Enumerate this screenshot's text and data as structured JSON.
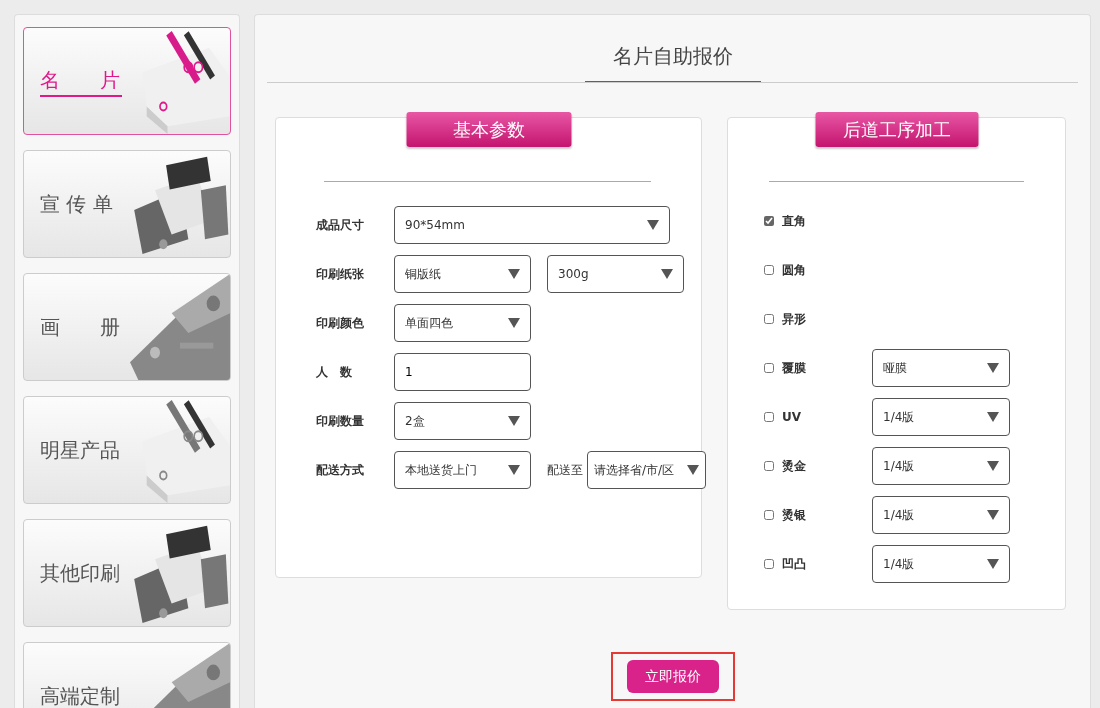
{
  "sidebar": {
    "items": [
      {
        "label": "名　　片",
        "selected": true
      },
      {
        "label": "宣 传 单",
        "selected": false
      },
      {
        "label": "画　　册",
        "selected": false
      },
      {
        "label": "明星产品",
        "selected": false
      },
      {
        "label": "其他印刷",
        "selected": false
      },
      {
        "label": "高端定制",
        "selected": false
      }
    ]
  },
  "title": "名片自助报价",
  "basic": {
    "heading": "基本参数",
    "rows": [
      {
        "label": "成品尺寸",
        "controls": [
          {
            "kind": "select",
            "value": "90*54mm"
          }
        ]
      },
      {
        "label": "印刷纸张",
        "controls": [
          {
            "kind": "select",
            "value": "铜版纸"
          },
          {
            "kind": "select",
            "value": "300g"
          }
        ]
      },
      {
        "label": "印刷颜色",
        "controls": [
          {
            "kind": "select",
            "value": "单面四色"
          }
        ]
      },
      {
        "label": "人　数",
        "controls": [
          {
            "kind": "input",
            "value": "1"
          }
        ]
      },
      {
        "label": "印刷数量",
        "controls": [
          {
            "kind": "select",
            "value": "2盒"
          }
        ]
      },
      {
        "label": "配送方式",
        "controls": [
          {
            "kind": "select",
            "value": "本地送货上门"
          },
          {
            "kind": "text",
            "value": "配送至"
          },
          {
            "kind": "select",
            "value": "请选择省/市/区"
          }
        ]
      }
    ]
  },
  "finishing": {
    "heading": "后道工序加工",
    "options": [
      {
        "label": "直角",
        "checked": true
      },
      {
        "label": "圆角",
        "checked": false
      },
      {
        "label": "异形",
        "checked": false
      },
      {
        "label": "覆膜",
        "checked": false,
        "select": "哑膜"
      },
      {
        "label": "UV",
        "checked": false,
        "select": "1/4版"
      },
      {
        "label": "烫金",
        "checked": false,
        "select": "1/4版"
      },
      {
        "label": "烫银",
        "checked": false,
        "select": "1/4版"
      },
      {
        "label": "凹凸",
        "checked": false,
        "select": "1/4版"
      }
    ]
  },
  "submit": {
    "label": "立即报价",
    "highlighted": true
  }
}
